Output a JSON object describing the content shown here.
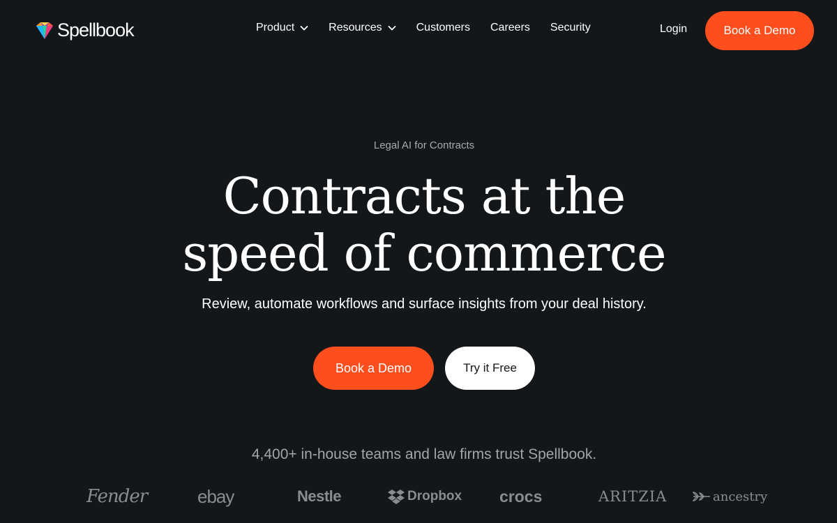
{
  "brand": {
    "name": "Spellbook"
  },
  "nav": {
    "items": [
      {
        "label": "Product",
        "has_dropdown": true
      },
      {
        "label": "Resources",
        "has_dropdown": true
      },
      {
        "label": "Customers",
        "has_dropdown": false
      },
      {
        "label": "Careers",
        "has_dropdown": false
      },
      {
        "label": "Security",
        "has_dropdown": false
      }
    ],
    "login": "Login",
    "cta": "Book a Demo"
  },
  "hero": {
    "eyebrow": "Legal AI for Contracts",
    "headline_line1": "Contracts at the",
    "headline_line2": "speed of commerce",
    "subhead": "Review, automate workflows and surface insights from your deal history.",
    "primary_cta": "Book a Demo",
    "secondary_cta": "Try it Free"
  },
  "trust": {
    "text": "4,400+ in-house teams and law firms trust Spellbook.",
    "logos": [
      "Fender",
      "ebay",
      "Nestle",
      "Dropbox",
      "crocs",
      "ARITZIA",
      "ancestry"
    ]
  },
  "colors": {
    "background": "#131719",
    "accent": "#ff4e1e",
    "muted_text": "#a3a6a8",
    "logo_gray": "#8a8d8f"
  }
}
